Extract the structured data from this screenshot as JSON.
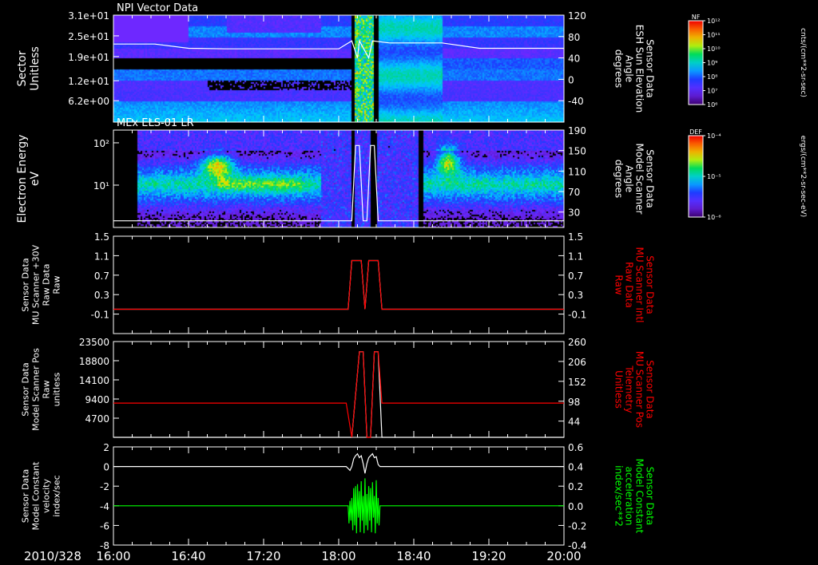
{
  "chart_data": {
    "type": "line",
    "date_label": "2010/328",
    "x_axis": {
      "range": [
        "16:00",
        "20:00"
      ],
      "tick_labels": [
        "16:00",
        "16:40",
        "17:20",
        "18:00",
        "18:40",
        "19:20",
        "20:00"
      ],
      "tick_minutes": [
        0,
        40,
        80,
        120,
        160,
        200,
        240
      ]
    },
    "panels": [
      {
        "id": "npi",
        "kind": "spectrogram",
        "title": "NPI Vector Data",
        "ylabel": [
          "Sector",
          "Unitless"
        ],
        "y_ticks": [
          "3.1e+01",
          "2.5e+01",
          "1.9e+01",
          "1.2e+01",
          "6.2e+00"
        ],
        "y_range": [
          0,
          31
        ],
        "y_tick_values": [
          31,
          25,
          19,
          12,
          6.2
        ],
        "y2label": [
          "Sensor Data",
          "ESH Sun Elevation",
          "Angle",
          "degrees"
        ],
        "y2_ticks": [
          "120",
          "80",
          "40",
          "0",
          "-40"
        ],
        "y2_tick_values": [
          120,
          80,
          40,
          0,
          -40
        ],
        "y2_range": [
          -80,
          120
        ],
        "colorbar": {
          "label": "NF",
          "units": "cnts/(cm**2-sr-sec)",
          "tick_labels": [
            "10¹²",
            "10¹¹",
            "10¹⁰",
            "10⁹",
            "10⁸",
            "10⁷",
            "10⁶"
          ]
        },
        "overlay_series": {
          "name": "Sun Elevation Angle",
          "color": "#ffffff",
          "points": [
            [
              0,
              66
            ],
            [
              22,
              66
            ],
            [
              40,
              58
            ],
            [
              60,
              57
            ],
            [
              95,
              57
            ],
            [
              120,
              57
            ],
            [
              127,
              72
            ],
            [
              130,
              40
            ],
            [
              131,
              72
            ],
            [
              136,
              40
            ],
            [
              138,
              72
            ],
            [
              147,
              68
            ],
            [
              160,
              68
            ],
            [
              175,
              68
            ],
            [
              195,
              58
            ],
            [
              215,
              58
            ],
            [
              240,
              58
            ]
          ]
        }
      },
      {
        "id": "els",
        "kind": "spectrogram",
        "title": "MEx ELS-01 LR",
        "ylabel": [
          "Electron Energy",
          "eV"
        ],
        "y_ticks": [
          "10²",
          "10¹"
        ],
        "y_log": true,
        "y_range": [
          1,
          200
        ],
        "y_tick_values": [
          100,
          10
        ],
        "y2label": [
          "Sensor Data",
          "Model Scanner",
          "Angle",
          "degrees"
        ],
        "y2_ticks": [
          "190",
          "150",
          "110",
          "70",
          "30"
        ],
        "y2_tick_values": [
          190,
          150,
          110,
          70,
          30
        ],
        "y2_range": [
          0,
          190
        ],
        "colorbar": {
          "label": "DEF",
          "units": "ergs/(cm**2-sr-sec-eV)",
          "tick_labels": [
            "10⁻⁴",
            "10⁻⁵",
            "10⁻⁶"
          ]
        },
        "overlay_series": {
          "name": "Model Scanner Angle",
          "color": "#ffffff",
          "points": [
            [
              0,
              13
            ],
            [
              124,
              13
            ],
            [
              127,
              13
            ],
            [
              129,
              160
            ],
            [
              131,
              160
            ],
            [
              133,
              13
            ],
            [
              135,
              13
            ],
            [
              137,
              160
            ],
            [
              139,
              160
            ],
            [
              141,
              13
            ],
            [
              240,
              13
            ]
          ]
        }
      },
      {
        "id": "mu_raw",
        "kind": "line",
        "ylabel": [
          "Sensor Data",
          "MU Scanner +30V",
          "Raw Data",
          "Raw"
        ],
        "y_ticks": [
          "1.5",
          "1.1",
          "0.7",
          "0.3",
          "-0.1"
        ],
        "y_tick_values": [
          1.5,
          1.1,
          0.7,
          0.3,
          -0.1
        ],
        "y_range": [
          -0.5,
          1.5
        ],
        "y2label": [
          "Sensor Data",
          "MU Scanner Intl",
          "Raw Data",
          "Raw"
        ],
        "y2label_color": "#ff0000",
        "y2_ticks": [
          "1.5",
          "1.1",
          "0.7",
          "0.3",
          "-0.1"
        ],
        "y2_tick_values": [
          1.5,
          1.1,
          0.7,
          0.3,
          -0.1
        ],
        "y2_range": [
          -0.5,
          1.5
        ],
        "series": [
          {
            "name": "MU Scanner +30V Raw Data",
            "color": "#ffffff",
            "points": [
              [
                0,
                0
              ],
              [
                125,
                0
              ],
              [
                127,
                1
              ],
              [
                132,
                1
              ],
              [
                134,
                0
              ],
              [
                136,
                1
              ],
              [
                141,
                1
              ],
              [
                143,
                0
              ],
              [
                240,
                0
              ]
            ]
          },
          {
            "name": "MU Scanner Intl Raw Data",
            "color": "#ff0000",
            "points": [
              [
                0,
                0
              ],
              [
                125,
                0
              ],
              [
                127,
                1
              ],
              [
                132,
                1
              ],
              [
                134,
                0
              ],
              [
                136,
                1
              ],
              [
                141,
                1
              ],
              [
                143,
                0
              ],
              [
                240,
                0
              ]
            ]
          }
        ]
      },
      {
        "id": "scan_pos",
        "kind": "line",
        "ylabel": [
          "Sensor Data",
          "Model Scanner Pos",
          "Raw",
          "unitless"
        ],
        "y_ticks": [
          "23500",
          "18800",
          "14100",
          "9400",
          "4700"
        ],
        "y_tick_values": [
          23500,
          18800,
          14100,
          9400,
          4700
        ],
        "y_range": [
          0,
          23500
        ],
        "y2label": [
          "Sensor Data",
          "MU Scanner Pos",
          "Telemetry",
          "Unitless"
        ],
        "y2label_color": "#ff0000",
        "y2_ticks": [
          "260",
          "206",
          "152",
          "98",
          "44"
        ],
        "y2_tick_values": [
          260,
          206,
          152,
          98,
          44
        ],
        "y2_range": [
          0,
          260
        ],
        "series": [
          {
            "name": "Model Scanner Pos",
            "color": "#ffffff",
            "points": [
              [
                0,
                0
              ],
              [
                124,
                0
              ],
              [
                127,
                0
              ],
              [
                131,
                21000
              ],
              [
                133,
                21000
              ],
              [
                135,
                0
              ],
              [
                137,
                0
              ],
              [
                139,
                21000
              ],
              [
                141,
                21000
              ],
              [
                143,
                0
              ],
              [
                240,
                0
              ]
            ]
          },
          {
            "name": "MU Scanner Pos Telemetry",
            "color": "#ff0000",
            "points": [
              [
                0,
                8400
              ],
              [
                124,
                8400
              ],
              [
                127,
                0
              ],
              [
                131,
                21000
              ],
              [
                133,
                21000
              ],
              [
                135,
                0
              ],
              [
                137,
                0
              ],
              [
                139,
                21000
              ],
              [
                141,
                21000
              ],
              [
                143,
                8400
              ],
              [
                240,
                8400
              ]
            ]
          }
        ]
      },
      {
        "id": "velocity",
        "kind": "line",
        "ylabel": [
          "Sensor Data",
          "Model Constant",
          "velocity",
          "index/sec"
        ],
        "y_ticks": [
          "2",
          "0",
          "-2",
          "-4",
          "-6",
          "-8"
        ],
        "y_tick_values": [
          2,
          0,
          -2,
          -4,
          -6,
          -8
        ],
        "y_range": [
          -8,
          2
        ],
        "y2label": [
          "Sensor Data",
          "Model Constant",
          "acceleration",
          "index/sec**2"
        ],
        "y2label_color": "#00ff00",
        "y2_ticks": [
          "0.6",
          "0.4",
          "0.2",
          "0.0",
          "-0.2",
          "-0.4"
        ],
        "y2_tick_values": [
          0.6,
          0.4,
          0.2,
          0.0,
          -0.2,
          -0.4
        ],
        "y2_range": [
          -0.4,
          0.6
        ],
        "series": [
          {
            "name": "Model Constant velocity",
            "color": "#ffffff",
            "points": [
              [
                0,
                0
              ],
              [
                124,
                0
              ],
              [
                126,
                -0.4
              ],
              [
                127,
                0
              ],
              [
                128,
                0.8
              ],
              [
                129,
                1.1
              ],
              [
                130,
                1.3
              ],
              [
                131,
                0.9
              ],
              [
                132,
                1.1
              ],
              [
                133,
                0.3
              ],
              [
                134,
                -0.7
              ],
              [
                135,
                0.3
              ],
              [
                136,
                0.9
              ],
              [
                137,
                1.1
              ],
              [
                138,
                1.3
              ],
              [
                139,
                0.9
              ],
              [
                140,
                1.0
              ],
              [
                141,
                0.2
              ],
              [
                142,
                0
              ],
              [
                240,
                0
              ]
            ]
          },
          {
            "name": "Model Constant acceleration",
            "color": "#00ff00",
            "axis": "right",
            "points": [
              [
                0,
                0
              ],
              [
                125,
                0
              ],
              [
                125.5,
                -0.18
              ],
              [
                126,
                0.05
              ],
              [
                126.5,
                -0.15
              ],
              [
                127,
                0.08
              ],
              [
                127.5,
                -0.25
              ],
              [
                128,
                0.18
              ],
              [
                128.5,
                -0.2
              ],
              [
                129,
                0.2
              ],
              [
                129.5,
                -0.28
              ],
              [
                130,
                0.22
              ],
              [
                130.5,
                -0.12
              ],
              [
                131,
                0.15
              ],
              [
                131.5,
                -0.27
              ],
              [
                132,
                0.25
              ],
              [
                132.5,
                -0.15
              ],
              [
                133,
                0.1
              ],
              [
                133.5,
                -0.28
              ],
              [
                134,
                0.28
              ],
              [
                134.5,
                -0.2
              ],
              [
                135,
                0.12
              ],
              [
                135.5,
                -0.25
              ],
              [
                136,
                0.2
              ],
              [
                136.5,
                -0.15
              ],
              [
                137,
                0.18
              ],
              [
                137.5,
                -0.27
              ],
              [
                138,
                0.24
              ],
              [
                138.5,
                -0.12
              ],
              [
                139,
                0.1
              ],
              [
                139.5,
                -0.28
              ],
              [
                140,
                0.26
              ],
              [
                140.5,
                -0.18
              ],
              [
                141,
                0.08
              ],
              [
                141.5,
                -0.2
              ],
              [
                142,
                0
              ],
              [
                240,
                0
              ]
            ]
          }
        ]
      }
    ]
  }
}
